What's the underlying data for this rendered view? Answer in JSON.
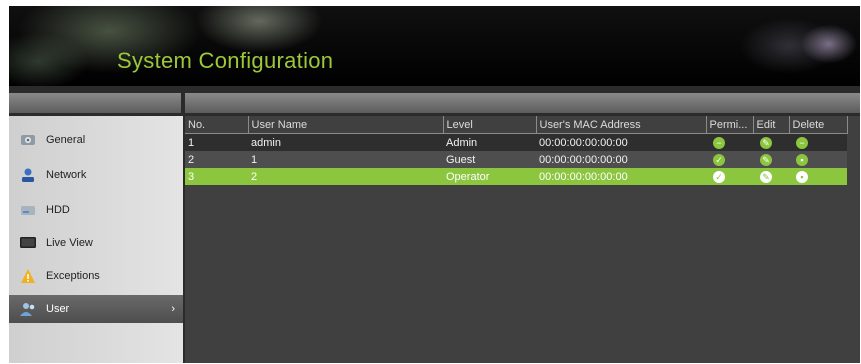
{
  "header": {
    "title": "System Configuration"
  },
  "sidebar": {
    "items": [
      {
        "label": "General",
        "icon": "general-settings-icon"
      },
      {
        "label": "Network",
        "icon": "network-icon"
      },
      {
        "label": "HDD",
        "icon": "hdd-icon"
      },
      {
        "label": "Live View",
        "icon": "monitor-icon"
      },
      {
        "label": "Exceptions",
        "icon": "warning-icon"
      },
      {
        "label": "User",
        "icon": "user-icon",
        "active": true,
        "arrow": "›"
      }
    ]
  },
  "table": {
    "columns": [
      "No.",
      "User Name",
      "Level",
      "User's MAC Address",
      "Permi...",
      "Edit",
      "Delete"
    ],
    "rows": [
      {
        "no": "1",
        "user": "admin",
        "level": "Admin",
        "mac": "00:00:00:00:00:00",
        "perm_icon": "minus-icon",
        "edit_icon": "edit-icon",
        "delete_icon": "minus-icon",
        "selected": false
      },
      {
        "no": "2",
        "user": "1",
        "level": "Guest",
        "mac": "00:00:00:00:00:00",
        "perm_icon": "check-icon",
        "edit_icon": "edit-icon",
        "delete_icon": "trash-icon",
        "selected": false
      },
      {
        "no": "3",
        "user": "2",
        "level": "Operator",
        "mac": "00:00:00:00:00:00",
        "perm_icon": "check-icon",
        "edit_icon": "edit-icon",
        "delete_icon": "trash-icon",
        "selected": true
      }
    ]
  },
  "colors": {
    "accent": "#8cc63f",
    "title": "#9dc83a"
  }
}
